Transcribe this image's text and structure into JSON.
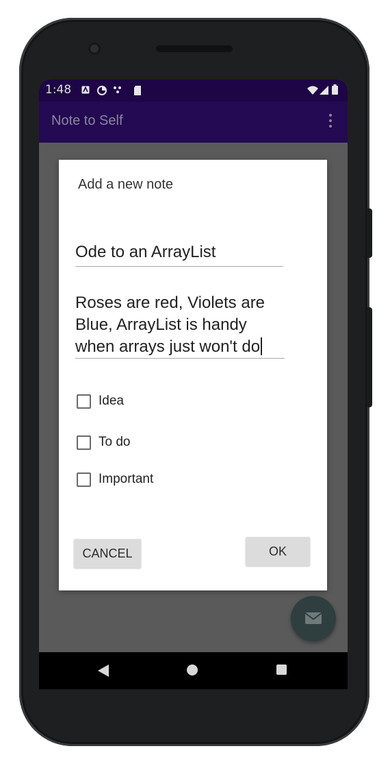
{
  "status_bar": {
    "time": "1:48",
    "left_icons": [
      "a-notification-icon",
      "data-saver-icon",
      "signal-dots-icon",
      "sd-card-icon"
    ],
    "right_icons": [
      "wifi-icon",
      "cell-signal-icon",
      "battery-icon"
    ]
  },
  "app_bar": {
    "title": "Note to Self",
    "menu_icon": "overflow-menu-icon"
  },
  "dialog": {
    "title": "Add a new note",
    "title_field_value": "Ode to an ArrayList",
    "description_value": "Roses are red, Violets are Blue, ArrayList is handy when arrays just won't do",
    "checkboxes": [
      {
        "label": "Idea",
        "checked": false
      },
      {
        "label": "To do",
        "checked": false
      },
      {
        "label": "Important",
        "checked": false
      }
    ],
    "cancel_label": "CANCEL",
    "ok_label": "OK"
  },
  "fab": {
    "icon": "email-icon"
  },
  "nav_bar": {
    "icons": [
      "back-icon",
      "home-icon",
      "recents-icon"
    ]
  },
  "colors": {
    "status_bar": "#1d0546",
    "app_bar": "#230a52",
    "scrim": "#5a5a5a",
    "fab": "#2f3e3e",
    "button": "#dcdcdc"
  }
}
